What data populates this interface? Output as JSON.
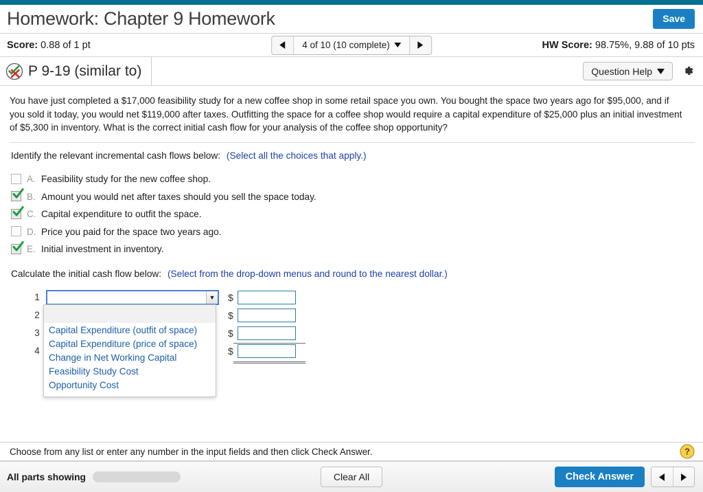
{
  "header": {
    "title": "Homework: Chapter 9 Homework",
    "save_label": "Save"
  },
  "score_bar": {
    "score_label": "Score:",
    "score_value": "0.88 of 1 pt",
    "nav_prev_icon": "left-triangle-icon",
    "nav_next_icon": "right-triangle-icon",
    "nav_label": "4 of 10 (10 complete)",
    "hw_score_label": "HW Score:",
    "hw_score_value": "98.75%, 9.88 of 10 pts"
  },
  "question_header": {
    "status_icon": "check-x-circle-icon",
    "question_id": "P 9-19 (similar to)",
    "help_label": "Question Help",
    "gear_icon": "gear-icon"
  },
  "question": {
    "text": "You have just completed a $17,000 feasibility study for a new coffee shop in some retail space you own. You bought the space two years ago for $95,000, and if you sold it today, you would net $119,000 after taxes. Outfitting the space for a coffee shop would require a capital expenditure of $25,000 plus an initial investment of $5,300 in inventory. What is the correct initial cash flow for your analysis of the coffee shop opportunity?"
  },
  "part_a": {
    "prompt": "Identify the relevant incremental cash flows below:",
    "hint": "(Select all the choices that apply.)",
    "choices": [
      {
        "letter": "A.",
        "text": "Feasibility study for the new coffee shop.",
        "checked": false
      },
      {
        "letter": "B.",
        "text": "Amount you would net after taxes should you sell the space today.",
        "checked": true
      },
      {
        "letter": "C.",
        "text": "Capital expenditure to outfit the space.",
        "checked": true
      },
      {
        "letter": "D.",
        "text": "Price you paid for the space two years ago.",
        "checked": false
      },
      {
        "letter": "E.",
        "text": "Initial investment in inventory.",
        "checked": true
      }
    ]
  },
  "part_b": {
    "prompt": "Calculate the initial cash flow below:",
    "hint": "(Select from the drop-down menus and round to the nearest dollar.)",
    "rows": [
      {
        "num": "1",
        "select_value": "",
        "currency": "$",
        "amount": ""
      },
      {
        "num": "2",
        "select_value": "",
        "currency": "$",
        "amount": ""
      },
      {
        "num": "3",
        "select_value": "",
        "currency": "$",
        "amount": ""
      },
      {
        "num": "4",
        "select_value": "",
        "currency": "$",
        "amount": ""
      }
    ],
    "dropdown_open": true,
    "dropdown_options": [
      "",
      "Capital Expenditure (outfit of space)",
      "Capital Expenditure (price of space)",
      "Change in Net Working Capital",
      "Feasibility Study Cost",
      "Opportunity Cost"
    ]
  },
  "footer": {
    "note": "Choose from any list or enter any number in the input fields and then click Check Answer.",
    "help_icon": "question-mark-help-icon",
    "parts_label": "All parts showing",
    "progress_percent": 100,
    "clear_all_label": "Clear All",
    "check_answer_label": "Check Answer",
    "prev_icon": "left-triangle-icon",
    "next_icon": "right-triangle-icon"
  },
  "colors": {
    "teal_strip": "#00718f",
    "primary_blue": "#1b7fc4",
    "link_blue": "#1b5faa",
    "hint_blue": "#1e3fa8",
    "check_green": "#17a03c",
    "x_red": "#d32f2f",
    "input_border": "#2a7f9e",
    "select_focus": "#4a7fd4"
  }
}
